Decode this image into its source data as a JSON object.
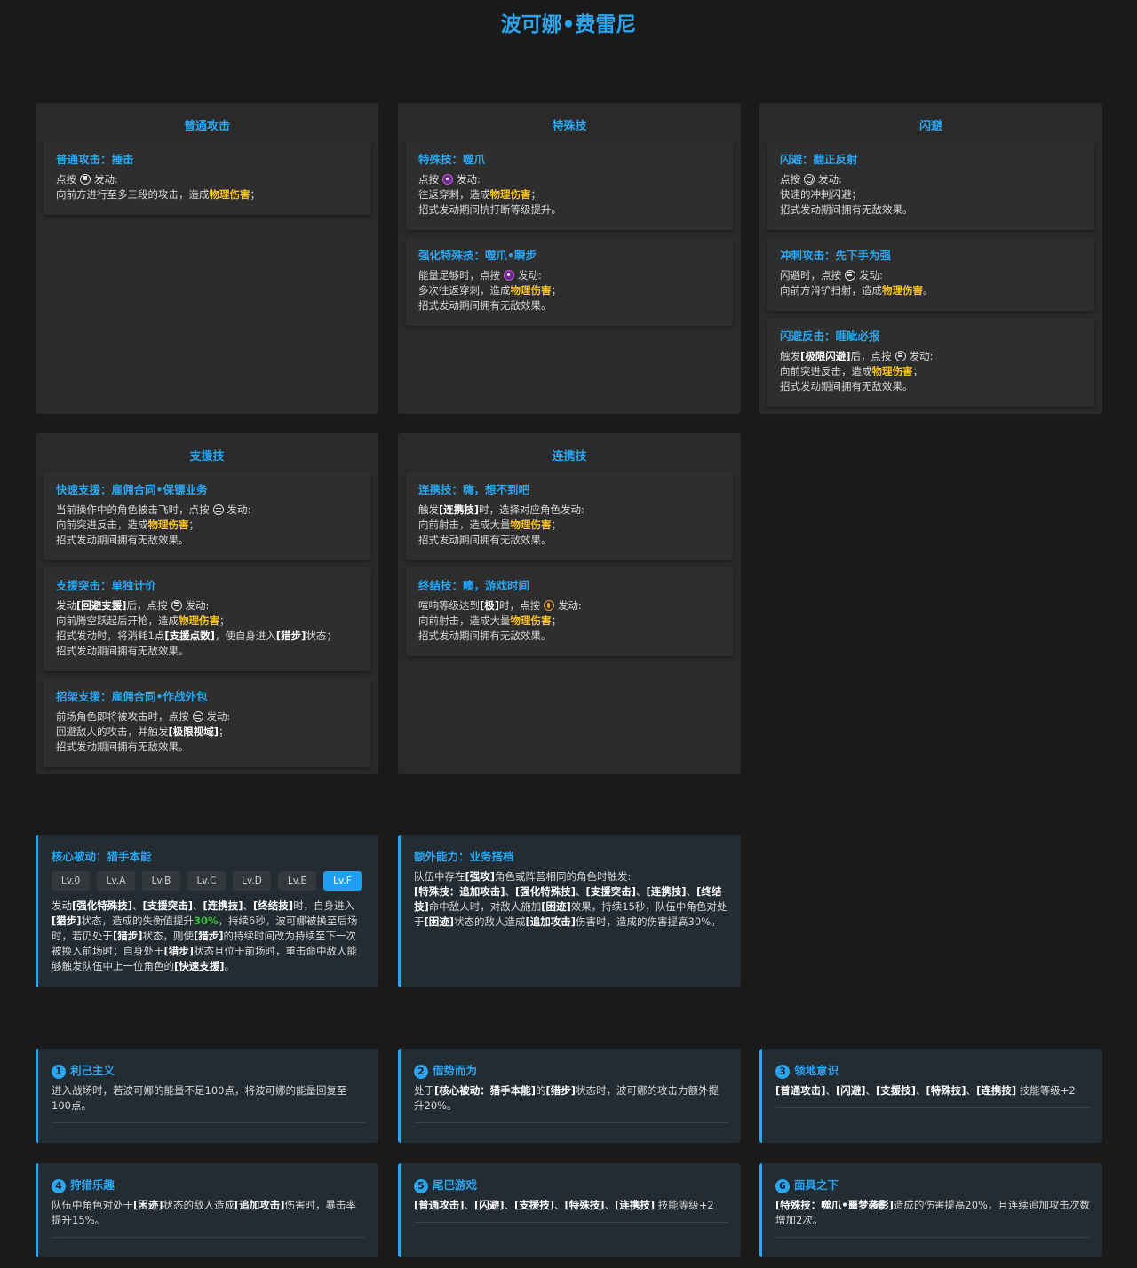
{
  "title": "波可娜•费雷尼",
  "basic": {
    "title": "普通攻击",
    "skills": [
      {
        "name": "普通攻击：捶击",
        "l1a": "点按",
        "l1b": "发动:",
        "l2a": "向前方进行至多三段的攻击，造成",
        "l2b": "物理伤害",
        "l2c": "；"
      }
    ]
  },
  "special": {
    "title": "特殊技",
    "skills": [
      {
        "name": "特殊技：噬爪",
        "l1a": "点按",
        "l1b": "发动:",
        "l2a": "往返穿刺，造成",
        "l2b": "物理伤害",
        "l2c": "；",
        "l3": "招式发动期间抗打断等级提升。"
      },
      {
        "name": "强化特殊技：噬爪•瞬步",
        "l1a": "能量足够时，点按",
        "l1b": "发动:",
        "l2a": "多次往返穿刺，造成",
        "l2b": "物理伤害",
        "l2c": "；",
        "l3": "招式发动期间拥有无敌效果。"
      }
    ]
  },
  "dodge": {
    "title": "闪避",
    "skills": [
      {
        "name": "闪避：翻正反射",
        "l1a": "点按",
        "l1b": "发动:",
        "l2": "快速的冲刺闪避；",
        "l3": "招式发动期间拥有无敌效果。"
      },
      {
        "name": "冲刺攻击：先下手为强",
        "l1a": "闪避时，点按",
        "l1b": "发动:",
        "l2a": "向前方滑铲扫射，造成",
        "l2b": "物理伤害",
        "l2c": "。"
      },
      {
        "name": "闪避反击：睚眦必报",
        "l1a": "触发",
        "l1b": "[极限闪避]",
        "l1c": "后，点按",
        "l1d": "发动:",
        "l2a": "向前突进反击，造成",
        "l2b": "物理伤害",
        "l2c": "；",
        "l3": "招式发动期间拥有无敌效果。"
      }
    ]
  },
  "assist": {
    "title": "支援技",
    "skills": [
      {
        "name": "快速支援：雇佣合同•保镖业务",
        "l1a": "当前操作中的角色被击飞时，点按",
        "l1b": "发动:",
        "l2a": "向前突进反击，造成",
        "l2b": "物理伤害",
        "l2c": "；",
        "l3": "招式发动期间拥有无敌效果。"
      },
      {
        "name": "支援突击：单独计价",
        "l1a": "发动",
        "l1b": "[回避支援]",
        "l1c": "后，点按",
        "l1d": "发动:",
        "l2a": "向前腾空跃起后开枪，造成",
        "l2b": "物理伤害",
        "l2c": "；",
        "l3a": "招式发动时，将消耗1点",
        "l3b": "[支援点数]",
        "l3c": "，使自身进入",
        "l3d": "[猎步]",
        "l3e": "状态；",
        "l4": "招式发动期间拥有无敌效果。"
      },
      {
        "name": "招架支援：雇佣合同•作战外包",
        "l1a": "前场角色即将被攻击时，点按",
        "l1b": "发动:",
        "l2a": "回避敌人的攻击，并触发",
        "l2b": "[极限视域]",
        "l2c": "；",
        "l3": "招式发动期间拥有无敌效果。"
      }
    ]
  },
  "chain": {
    "title": "连携技",
    "skills": [
      {
        "name": "连携技：嗨，想不到吧",
        "l1a": "触发",
        "l1b": "[连携技]",
        "l1c": "时，选择对应角色发动:",
        "l2a": "向前射击，造成大量",
        "l2b": "物理伤害",
        "l2c": "；",
        "l3": "招式发动期间拥有无敌效果。"
      },
      {
        "name": "终结技：噢，游戏时间",
        "l1a": "喧响等级达到",
        "l1b": "[极]",
        "l1c": "时，点按",
        "l1d": "发动:",
        "l2a": "向前射击，造成大量",
        "l2b": "物理伤害",
        "l2c": "；",
        "l3": "招式发动期间拥有无敌效果。"
      }
    ]
  },
  "core": {
    "title": "核心被动：猎手本能",
    "levels": [
      "Lv.0",
      "Lv.A",
      "Lv.B",
      "Lv.C",
      "Lv.D",
      "Lv.E",
      "Lv.F"
    ],
    "t1": "发动",
    "t2": "[强化特殊技]",
    "t3": "、",
    "t4": "[支援突击]",
    "t5": "、",
    "t6": "[连携技]",
    "t7": "、",
    "t8": "[终结技]",
    "t9": "时，自身进入",
    "t10": "[猎步]",
    "t11": "状态，造成的失衡值提升",
    "t12": "30%",
    "t13": "，持续6秒，波可娜被换至后场时，若仍处于",
    "t14": "[猎步]",
    "t15": "状态，则使",
    "t16": "[猎步]",
    "t17": "的持续时间改为持续至下一次被换入前场时；自身处于",
    "t18": "[猎步]",
    "t19": "状态且位于前场时，重击命中敌人能够触发队伍中上一位角色的",
    "t20": "[快速支援]",
    "t21": "。"
  },
  "extra": {
    "title": "额外能力：业务搭档",
    "t1": "队伍中存在",
    "t2": "[强攻]",
    "t3": "角色或阵营相同的角色时触发:",
    "t4": "[特殊技：追加攻击]",
    "t5": "、",
    "t6": "[强化特殊技]",
    "t7": "、",
    "t8": "[支援突击]",
    "t9": "、",
    "t10": "[连携技]",
    "t11": "、",
    "t12": "[终结技]",
    "t13": "命中敌人时，对敌人施加",
    "t14": "[困迹]",
    "t15": "效果，持续15秒，队伍中角色对处于",
    "t16": "[困迹]",
    "t17": "状态的敌人造成",
    "t18": "[追加攻击]",
    "t19": "伤害时，造成的伤害提高30%。"
  },
  "mindscapes": [
    {
      "num": "1",
      "name": "利己主义",
      "text": "进入战场时，若波可娜的能量不足100点，将波可娜的能量回复至100点。"
    },
    {
      "num": "2",
      "name": "借势而为",
      "a": "处于",
      "b": "[核心被动：猎手本能]",
      "c": "的",
      "d": "[猎步]",
      "e": "状态时，波可娜的攻击力额外提升20%。"
    },
    {
      "num": "3",
      "name": "领地意识",
      "a": "[普通攻击]",
      "b": "、",
      "c": "[闪避]",
      "d": "、",
      "e": "[支援技]",
      "f": "、",
      "g": "[特殊技]",
      "h": "、",
      "i": "[连携技]",
      "j": " 技能等级+2"
    },
    {
      "num": "4",
      "name": "狩猎乐趣",
      "a": "队伍中角色对处于",
      "b": "[困迹]",
      "c": "状态的敌人造成",
      "d": "[追加攻击]",
      "e": "伤害时，暴击率提升15%。"
    },
    {
      "num": "5",
      "name": "尾巴游戏",
      "a": "[普通攻击]",
      "b": "、",
      "c": "[闪避]",
      "d": "、",
      "e": "[支援技]",
      "f": "、",
      "g": "[特殊技]",
      "h": "、",
      "i": "[连携技]",
      "j": " 技能等级+2"
    },
    {
      "num": "6",
      "name": "面具之下",
      "a": "[特殊技：噬爪•噩梦袭影]",
      "b": "造成的伤害提高20%，且连续追加攻击次数增加2次。"
    }
  ]
}
